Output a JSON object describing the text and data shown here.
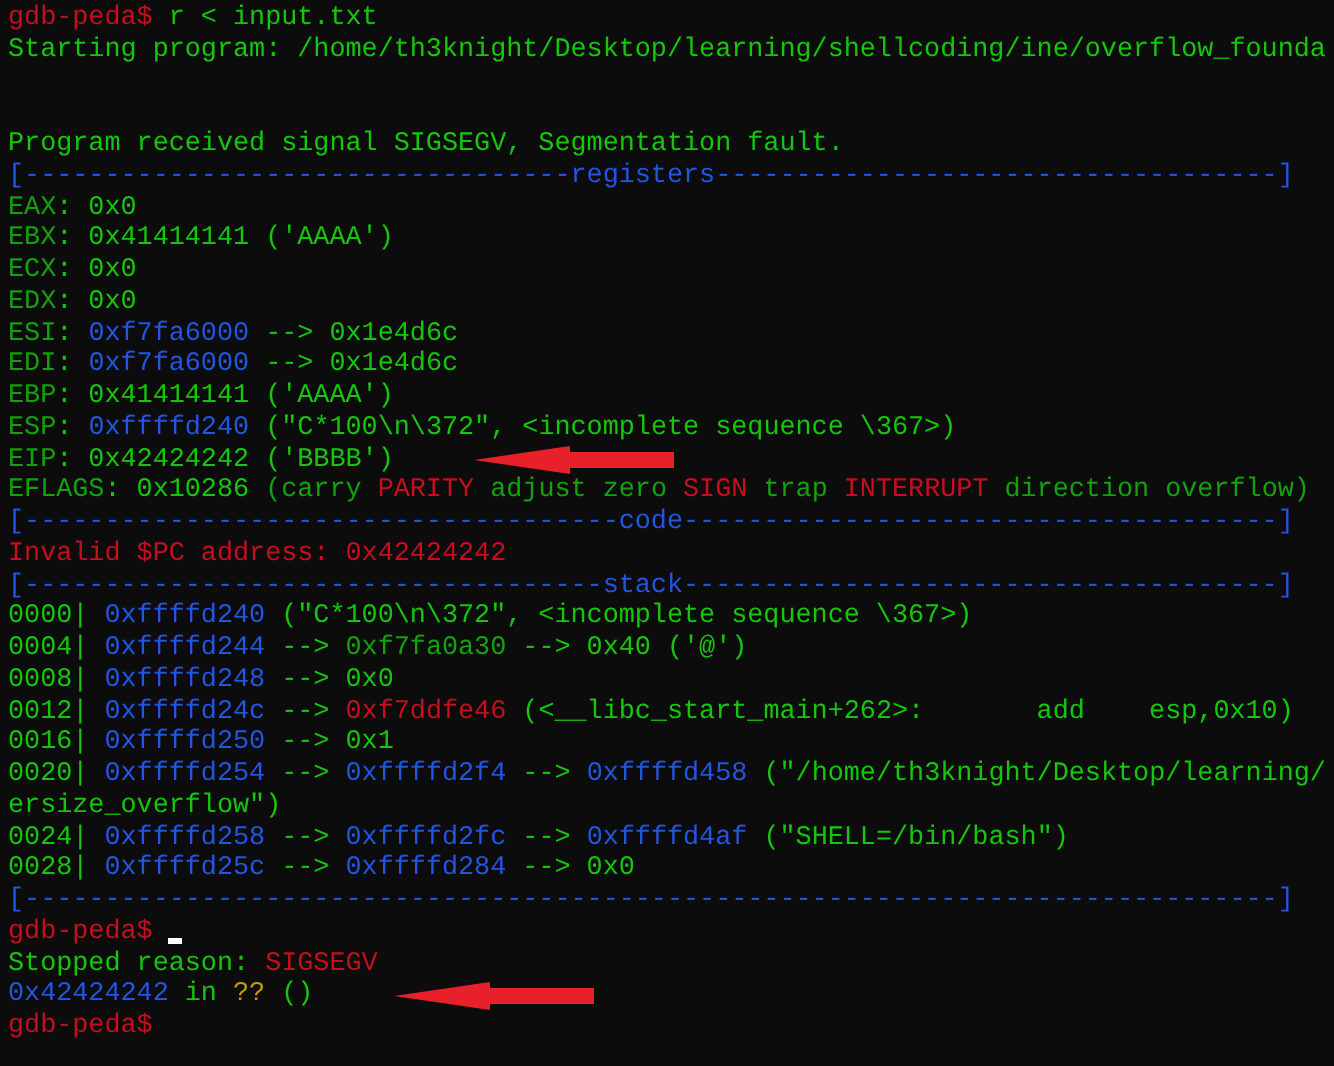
{
  "terminal": {
    "lines": [
      {
        "segments": [
          {
            "kind": "prompt",
            "text": "gdb-peda$"
          },
          {
            "kind": "plain",
            "text": " r < input.txt"
          }
        ]
      },
      {
        "segments": [
          {
            "kind": "plain",
            "text": "Starting program: /home/th3knight/Desktop/learning/shellcoding/ine/overflow_founda"
          }
        ]
      },
      {
        "gap_before": true,
        "segments": [
          {
            "kind": "plain",
            "text": "Program received signal SIGSEGV, Segmentation fault."
          }
        ]
      },
      {
        "segments": [
          {
            "kind": "address",
            "text": "[----------------------------------registers-----------------------------------]"
          }
        ]
      },
      {
        "segments": [
          {
            "kind": "dim",
            "text": "EAX"
          },
          {
            "kind": "plain",
            "text": ": 0x0"
          }
        ]
      },
      {
        "segments": [
          {
            "kind": "dim",
            "text": "EBX"
          },
          {
            "kind": "plain",
            "text": ": 0x41414141 ('AAAA')"
          }
        ]
      },
      {
        "segments": [
          {
            "kind": "dim",
            "text": "ECX"
          },
          {
            "kind": "plain",
            "text": ": 0x0"
          }
        ]
      },
      {
        "segments": [
          {
            "kind": "dim",
            "text": "EDX"
          },
          {
            "kind": "plain",
            "text": ": 0x0"
          }
        ]
      },
      {
        "segments": [
          {
            "kind": "dim",
            "text": "ESI"
          },
          {
            "kind": "plain",
            "text": ": "
          },
          {
            "kind": "address",
            "text": "0xf7fa6000"
          },
          {
            "kind": "plain",
            "text": " --> 0x1e4d6c"
          }
        ]
      },
      {
        "segments": [
          {
            "kind": "dim",
            "text": "EDI"
          },
          {
            "kind": "plain",
            "text": ": "
          },
          {
            "kind": "address",
            "text": "0xf7fa6000"
          },
          {
            "kind": "plain",
            "text": " --> 0x1e4d6c"
          }
        ]
      },
      {
        "segments": [
          {
            "kind": "dim",
            "text": "EBP"
          },
          {
            "kind": "plain",
            "text": ": 0x41414141 ('AAAA')"
          }
        ]
      },
      {
        "segments": [
          {
            "kind": "dim",
            "text": "ESP"
          },
          {
            "kind": "plain",
            "text": ": "
          },
          {
            "kind": "address",
            "text": "0xffffd240"
          },
          {
            "kind": "plain",
            "text": " (\"C*100\\n\\372\", <incomplete sequence \\367>)"
          }
        ]
      },
      {
        "arrow": true,
        "segments": [
          {
            "kind": "dim",
            "text": "EIP"
          },
          {
            "kind": "plain",
            "text": ": 0x42424242 ('BBBB')"
          }
        ]
      },
      {
        "segments": [
          {
            "kind": "dim",
            "text": "EFLAGS"
          },
          {
            "kind": "plain",
            "text": ": 0x10286 "
          },
          {
            "kind": "dim",
            "text": "(carry "
          },
          {
            "kind": "alert",
            "text": "PARITY"
          },
          {
            "kind": "dim",
            "text": " adjust zero "
          },
          {
            "kind": "alert",
            "text": "SIGN"
          },
          {
            "kind": "dim",
            "text": " trap "
          },
          {
            "kind": "alert",
            "text": "INTERRUPT"
          },
          {
            "kind": "dim",
            "text": " direction overflow)"
          }
        ]
      },
      {
        "segments": [
          {
            "kind": "address",
            "text": "[-------------------------------------code-------------------------------------]"
          }
        ]
      },
      {
        "segments": [
          {
            "kind": "alert",
            "text": "Invalid $PC address: 0x42424242"
          }
        ]
      },
      {
        "segments": [
          {
            "kind": "address",
            "text": "[------------------------------------stack-------------------------------------]"
          }
        ]
      },
      {
        "segments": [
          {
            "kind": "plain",
            "text": "0000| "
          },
          {
            "kind": "address",
            "text": "0xffffd240"
          },
          {
            "kind": "plain",
            "text": " (\"C*100\\n\\372\", <incomplete sequence \\367>)"
          }
        ]
      },
      {
        "segments": [
          {
            "kind": "plain",
            "text": "0004| "
          },
          {
            "kind": "address",
            "text": "0xffffd244"
          },
          {
            "kind": "plain",
            "text": " --> "
          },
          {
            "kind": "dim",
            "text": "0xf7fa0a30"
          },
          {
            "kind": "plain",
            "text": " --> 0x40 ('@')"
          }
        ]
      },
      {
        "segments": [
          {
            "kind": "plain",
            "text": "0008| "
          },
          {
            "kind": "address",
            "text": "0xffffd248"
          },
          {
            "kind": "plain",
            "text": " --> 0x0"
          }
        ]
      },
      {
        "segments": [
          {
            "kind": "plain",
            "text": "0012| "
          },
          {
            "kind": "address",
            "text": "0xffffd24c"
          },
          {
            "kind": "plain",
            "text": " --> "
          },
          {
            "kind": "alert",
            "text": "0xf7ddfe46"
          },
          {
            "kind": "plain",
            "text": " (<__libc_start_main+262>:       add    esp,0x10)"
          }
        ]
      },
      {
        "segments": [
          {
            "kind": "plain",
            "text": "0016| "
          },
          {
            "kind": "address",
            "text": "0xffffd250"
          },
          {
            "kind": "plain",
            "text": " --> 0x1"
          }
        ]
      },
      {
        "segments": [
          {
            "kind": "plain",
            "text": "0020| "
          },
          {
            "kind": "address",
            "text": "0xffffd254"
          },
          {
            "kind": "plain",
            "text": " --> "
          },
          {
            "kind": "address",
            "text": "0xffffd2f4"
          },
          {
            "kind": "plain",
            "text": " --> "
          },
          {
            "kind": "address",
            "text": "0xffffd458"
          },
          {
            "kind": "plain",
            "text": " (\"/home/th3knight/Desktop/learning/"
          }
        ]
      },
      {
        "segments": [
          {
            "kind": "plain",
            "text": "ersize_overflow\")"
          }
        ]
      },
      {
        "segments": [
          {
            "kind": "plain",
            "text": "0024| "
          },
          {
            "kind": "address",
            "text": "0xffffd258"
          },
          {
            "kind": "plain",
            "text": " --> "
          },
          {
            "kind": "address",
            "text": "0xffffd2fc"
          },
          {
            "kind": "plain",
            "text": " --> "
          },
          {
            "kind": "address",
            "text": "0xffffd4af"
          },
          {
            "kind": "plain",
            "text": " (\"SHELL=/bin/bash\")"
          }
        ]
      },
      {
        "segments": [
          {
            "kind": "plain",
            "text": "0028| "
          },
          {
            "kind": "address",
            "text": "0xffffd25c"
          },
          {
            "kind": "plain",
            "text": " --> "
          },
          {
            "kind": "address",
            "text": "0xffffd284"
          },
          {
            "kind": "plain",
            "text": " --> 0x0"
          }
        ]
      },
      {
        "segments": [
          {
            "kind": "address",
            "text": "[------------------------------------------------------------------------------]"
          }
        ]
      },
      {
        "cursor": true,
        "segments": [
          {
            "kind": "prompt",
            "text": "gdb-peda$"
          }
        ]
      },
      {
        "segments": [
          {
            "kind": "plain",
            "text": "Stopped reason: "
          },
          {
            "kind": "alert",
            "text": "SIGSEGV"
          }
        ]
      },
      {
        "arrow": true,
        "segments": [
          {
            "kind": "address",
            "text": "0x42424242"
          },
          {
            "kind": "plain",
            "text": " in "
          },
          {
            "kind": "unknown",
            "text": "??"
          },
          {
            "kind": "plain",
            "text": " ()"
          }
        ]
      },
      {
        "segments": [
          {
            "kind": "prompt",
            "text": "gdb-peda$"
          }
        ]
      }
    ]
  }
}
